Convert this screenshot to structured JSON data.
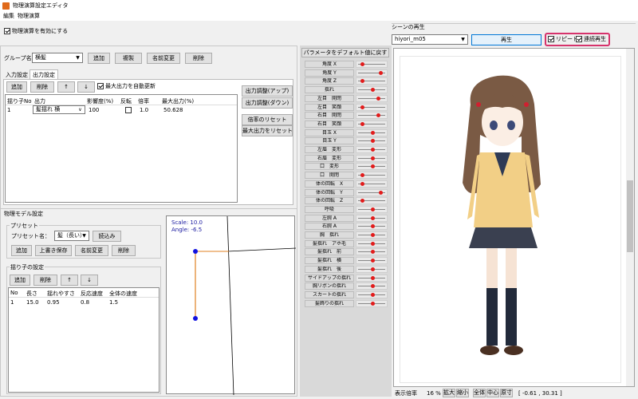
{
  "window": {
    "title": "物理演算設定エディタ"
  },
  "menu": [
    "編集",
    "物理演算"
  ],
  "enable_physics": "物理演算を有効にする",
  "group": {
    "label": "グループ名：",
    "value": "横髪",
    "add": "追加",
    "copy": "複製",
    "rename": "名前変更",
    "delete": "削除"
  },
  "tabs": [
    "入力設定",
    "出力設定"
  ],
  "output": {
    "add": "追加",
    "delete": "削除",
    "up": "↑",
    "down": "↓",
    "auto_update": "最大出力を自動更新",
    "headers": [
      "揺り子No",
      "出力",
      "影響度(%)",
      "反転",
      "倍率",
      "最大出力(%)"
    ],
    "rows": [
      {
        "no": "1",
        "output": "髪揺れ 横",
        "influence": "100",
        "flip": "",
        "scale": "1.0",
        "max": "50.628"
      }
    ],
    "adjust_up": "出力調整(アップ)",
    "adjust_down": "出力調整(ダウン)",
    "reset_scale": "倍率のリセット",
    "reset_max": "最大出力をリセット"
  },
  "model": {
    "title": "物理モデル設定",
    "preset_title": "プリセット",
    "preset_label": "プリセット名：",
    "preset_value": "髪（長い）",
    "load": "読込み",
    "add": "追加",
    "overwrite": "上書き保存",
    "rename": "名前変更",
    "delete": "削除",
    "pendulum_title": "揺り子の設定",
    "p_add": "追加",
    "p_delete": "削除",
    "p_up": "↑",
    "p_down": "↓",
    "headers": [
      "No",
      "長さ",
      "揺れやすさ",
      "反応速度",
      "全体の速度"
    ],
    "rows": [
      {
        "no": "1",
        "length": "15.0",
        "sway": "0.95",
        "reaction": "0.8",
        "speed": "1.5"
      }
    ]
  },
  "preview": {
    "scale": "Scale: 10.0",
    "angle": "Angle: -6.5"
  },
  "params": {
    "reset": "パラメータをデフォルト値に戻す",
    "items": [
      {
        "name": "角度 X",
        "v": 0.1
      },
      {
        "name": "角度 Y",
        "v": 0.85
      },
      {
        "name": "角度 Z",
        "v": 0.1
      },
      {
        "name": "揺れ",
        "v": 0.5
      },
      {
        "name": "左目　開閉",
        "v": 0.75
      },
      {
        "name": "左目　笑顔",
        "v": 0.1
      },
      {
        "name": "右目　開閉",
        "v": 0.75
      },
      {
        "name": "右目　笑顔",
        "v": 0.1
      },
      {
        "name": "目玉 X",
        "v": 0.5
      },
      {
        "name": "目玉 Y",
        "v": 0.5
      },
      {
        "name": "左眉　変形",
        "v": 0.5
      },
      {
        "name": "右眉　変形",
        "v": 0.5
      },
      {
        "name": "口　変形",
        "v": 0.5
      },
      {
        "name": "口　開閉",
        "v": 0.1
      },
      {
        "name": "体の回転　X",
        "v": 0.1
      },
      {
        "name": "体の回転　Y",
        "v": 0.85
      },
      {
        "name": "体の回転　Z",
        "v": 0.1
      },
      {
        "name": "呼吸",
        "v": 0.5
      },
      {
        "name": "左腕 A",
        "v": 0.5
      },
      {
        "name": "右腕 A",
        "v": 0.5
      },
      {
        "name": "胸　揺れ",
        "v": 0.5
      },
      {
        "name": "髪揺れ　アホ毛",
        "v": 0.5
      },
      {
        "name": "髪揺れ　前",
        "v": 0.5
      },
      {
        "name": "髪揺れ　横",
        "v": 0.5
      },
      {
        "name": "髪揺れ　後",
        "v": 0.5
      },
      {
        "name": "サイドアップの揺れ",
        "v": 0.5
      },
      {
        "name": "胸リボンの揺れ",
        "v": 0.5
      },
      {
        "name": "スカートの揺れ",
        "v": 0.5
      },
      {
        "name": "髪飾りの揺れ",
        "v": 0.5
      }
    ]
  },
  "scene": {
    "title": "シーンの再生",
    "motion": "hiyori_m05",
    "play": "再生",
    "repeat": "リピート",
    "continuous": "連続再生"
  },
  "status": {
    "zoom_label": "表示倍率",
    "zoom": "16 %",
    "zoom_in": "拡大",
    "zoom_out": "縮小",
    "whole": "全体",
    "center": "中心",
    "actual": "原寸",
    "coords": "[ -0.61 , 30.31 ]"
  },
  "colors": {
    "accent": "#d6336c",
    "handle": "#1010e0",
    "link": "#e08020"
  }
}
